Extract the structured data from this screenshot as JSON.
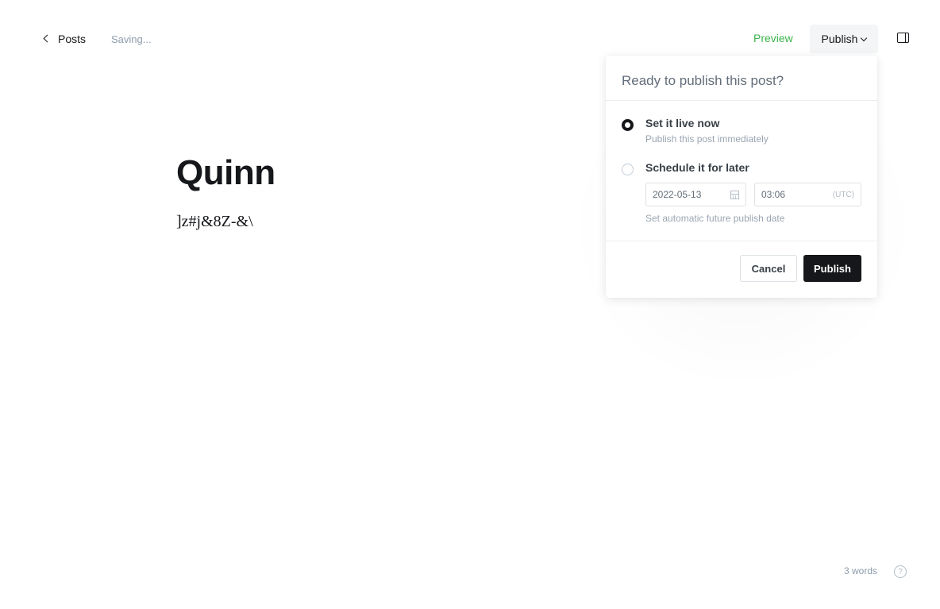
{
  "header": {
    "back_label": "Posts",
    "status": "Saving...",
    "preview_label": "Preview",
    "publish_label": "Publish"
  },
  "editor": {
    "title": "Quinn",
    "body": "]z#j&8Z-&\\"
  },
  "publish_menu": {
    "heading": "Ready to publish this post?",
    "options": [
      {
        "title": "Set it live now",
        "description": "Publish this post immediately",
        "selected": true
      },
      {
        "title": "Schedule it for later",
        "description": "Set automatic future publish date",
        "selected": false
      }
    ],
    "date_value": "2022-05-13",
    "time_value": "03:06",
    "timezone": "(UTC)",
    "cancel_label": "Cancel",
    "publish_label": "Publish"
  },
  "footer": {
    "word_count": "3 words",
    "help_glyph": "?"
  },
  "colors": {
    "preview": "#3bb44d",
    "primary_button": "#15171a"
  },
  "icons": {
    "back": "chevron-left-icon",
    "dropdown": "chevron-down-icon",
    "sidebar": "sidebar-toggle-icon",
    "calendar": "calendar-icon",
    "help": "help-icon"
  }
}
